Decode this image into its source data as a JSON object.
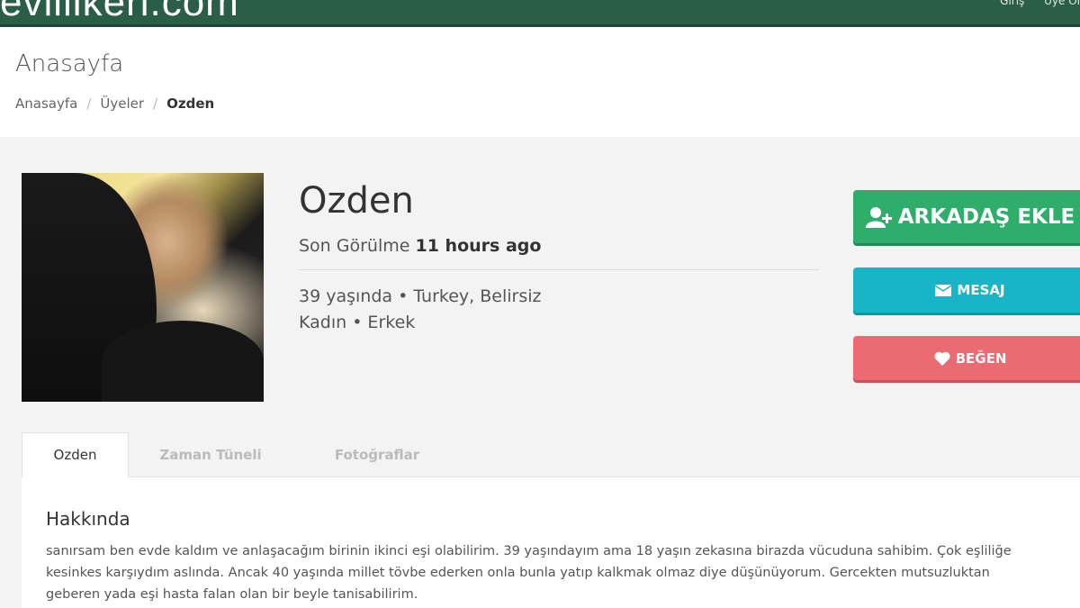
{
  "site": {
    "logo": "evlilikeri.com",
    "top_links": [
      "Giriş",
      "Üye Ol"
    ]
  },
  "page": {
    "title": "Anasayfa"
  },
  "breadcrumb": {
    "items": [
      "Anasayfa",
      "Üyeler"
    ],
    "current": "Ozden"
  },
  "profile": {
    "name": "Ozden",
    "last_seen_label": "Son Görülme",
    "last_seen_value": "11 hours ago",
    "info_line1": "39 yaşında • Turkey, Belirsiz",
    "info_line2": "Kadın • Erkek"
  },
  "actions": {
    "add_friend": "ARKADAŞ EKLE",
    "message": "MESAJ",
    "like": "BEĞEN"
  },
  "tabs": [
    {
      "label": "Ozden",
      "active": true
    },
    {
      "label": "Zaman Tüneli",
      "active": false
    },
    {
      "label": "Fotoğraflar",
      "active": false
    }
  ],
  "about": {
    "title": "Hakkında",
    "text": "sanırsam ben evde kaldım ve anlaşacağım birinin ikinci eşi olabilirim. 39 yaşındayım ama 18 yaşın zekasına birazda vücuduna sahibim. Çok eşliliğe kesinkes karşıydım aslında. Ancak 40 yaşında millet tövbe ederken onla bunla yatıp kalkmak olmaz diye düşünüyorum. Gercekten mutsuzluktan geberen yada eşi hasta falan olan bir beyle tanisabilirim."
  },
  "colors": {
    "topbar": "#2b5e46",
    "add_friend": "#2fae6b",
    "message": "#19b5c6",
    "like": "#ec6a72"
  },
  "icons": {
    "add_friend": "user-plus-icon",
    "message": "envelope-icon",
    "like": "heart-icon"
  }
}
